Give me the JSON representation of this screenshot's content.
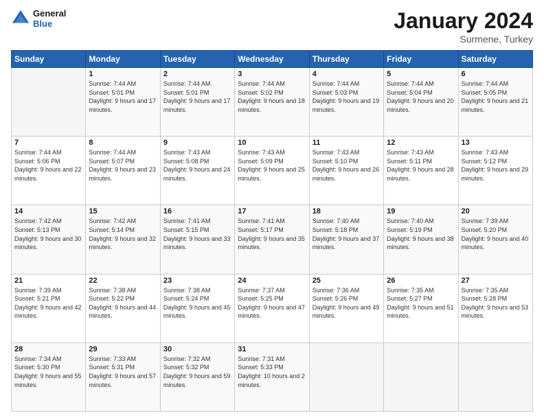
{
  "logo": {
    "line1": "General",
    "line2": "Blue"
  },
  "title": "January 2024",
  "subtitle": "Surmene, Turkey",
  "header": {
    "days": [
      "Sunday",
      "Monday",
      "Tuesday",
      "Wednesday",
      "Thursday",
      "Friday",
      "Saturday"
    ]
  },
  "weeks": [
    [
      {
        "day": "",
        "sunrise": "",
        "sunset": "",
        "daylight": ""
      },
      {
        "day": "1",
        "sunrise": "Sunrise: 7:44 AM",
        "sunset": "Sunset: 5:01 PM",
        "daylight": "Daylight: 9 hours and 17 minutes."
      },
      {
        "day": "2",
        "sunrise": "Sunrise: 7:44 AM",
        "sunset": "Sunset: 5:01 PM",
        "daylight": "Daylight: 9 hours and 17 minutes."
      },
      {
        "day": "3",
        "sunrise": "Sunrise: 7:44 AM",
        "sunset": "Sunset: 5:02 PM",
        "daylight": "Daylight: 9 hours and 18 minutes."
      },
      {
        "day": "4",
        "sunrise": "Sunrise: 7:44 AM",
        "sunset": "Sunset: 5:03 PM",
        "daylight": "Daylight: 9 hours and 19 minutes."
      },
      {
        "day": "5",
        "sunrise": "Sunrise: 7:44 AM",
        "sunset": "Sunset: 5:04 PM",
        "daylight": "Daylight: 9 hours and 20 minutes."
      },
      {
        "day": "6",
        "sunrise": "Sunrise: 7:44 AM",
        "sunset": "Sunset: 5:05 PM",
        "daylight": "Daylight: 9 hours and 21 minutes."
      }
    ],
    [
      {
        "day": "7",
        "sunrise": "Sunrise: 7:44 AM",
        "sunset": "Sunset: 5:06 PM",
        "daylight": "Daylight: 9 hours and 22 minutes."
      },
      {
        "day": "8",
        "sunrise": "Sunrise: 7:44 AM",
        "sunset": "Sunset: 5:07 PM",
        "daylight": "Daylight: 9 hours and 23 minutes."
      },
      {
        "day": "9",
        "sunrise": "Sunrise: 7:43 AM",
        "sunset": "Sunset: 5:08 PM",
        "daylight": "Daylight: 9 hours and 24 minutes."
      },
      {
        "day": "10",
        "sunrise": "Sunrise: 7:43 AM",
        "sunset": "Sunset: 5:09 PM",
        "daylight": "Daylight: 9 hours and 25 minutes."
      },
      {
        "day": "11",
        "sunrise": "Sunrise: 7:43 AM",
        "sunset": "Sunset: 5:10 PM",
        "daylight": "Daylight: 9 hours and 26 minutes."
      },
      {
        "day": "12",
        "sunrise": "Sunrise: 7:43 AM",
        "sunset": "Sunset: 5:11 PM",
        "daylight": "Daylight: 9 hours and 28 minutes."
      },
      {
        "day": "13",
        "sunrise": "Sunrise: 7:43 AM",
        "sunset": "Sunset: 5:12 PM",
        "daylight": "Daylight: 9 hours and 29 minutes."
      }
    ],
    [
      {
        "day": "14",
        "sunrise": "Sunrise: 7:42 AM",
        "sunset": "Sunset: 5:13 PM",
        "daylight": "Daylight: 9 hours and 30 minutes."
      },
      {
        "day": "15",
        "sunrise": "Sunrise: 7:42 AM",
        "sunset": "Sunset: 5:14 PM",
        "daylight": "Daylight: 9 hours and 32 minutes."
      },
      {
        "day": "16",
        "sunrise": "Sunrise: 7:41 AM",
        "sunset": "Sunset: 5:15 PM",
        "daylight": "Daylight: 9 hours and 33 minutes."
      },
      {
        "day": "17",
        "sunrise": "Sunrise: 7:41 AM",
        "sunset": "Sunset: 5:17 PM",
        "daylight": "Daylight: 9 hours and 35 minutes."
      },
      {
        "day": "18",
        "sunrise": "Sunrise: 7:40 AM",
        "sunset": "Sunset: 5:18 PM",
        "daylight": "Daylight: 9 hours and 37 minutes."
      },
      {
        "day": "19",
        "sunrise": "Sunrise: 7:40 AM",
        "sunset": "Sunset: 5:19 PM",
        "daylight": "Daylight: 9 hours and 38 minutes."
      },
      {
        "day": "20",
        "sunrise": "Sunrise: 7:39 AM",
        "sunset": "Sunset: 5:20 PM",
        "daylight": "Daylight: 9 hours and 40 minutes."
      }
    ],
    [
      {
        "day": "21",
        "sunrise": "Sunrise: 7:39 AM",
        "sunset": "Sunset: 5:21 PM",
        "daylight": "Daylight: 9 hours and 42 minutes."
      },
      {
        "day": "22",
        "sunrise": "Sunrise: 7:38 AM",
        "sunset": "Sunset: 5:22 PM",
        "daylight": "Daylight: 9 hours and 44 minutes."
      },
      {
        "day": "23",
        "sunrise": "Sunrise: 7:38 AM",
        "sunset": "Sunset: 5:24 PM",
        "daylight": "Daylight: 9 hours and 45 minutes."
      },
      {
        "day": "24",
        "sunrise": "Sunrise: 7:37 AM",
        "sunset": "Sunset: 5:25 PM",
        "daylight": "Daylight: 9 hours and 47 minutes."
      },
      {
        "day": "25",
        "sunrise": "Sunrise: 7:36 AM",
        "sunset": "Sunset: 5:26 PM",
        "daylight": "Daylight: 9 hours and 49 minutes."
      },
      {
        "day": "26",
        "sunrise": "Sunrise: 7:35 AM",
        "sunset": "Sunset: 5:27 PM",
        "daylight": "Daylight: 9 hours and 51 minutes."
      },
      {
        "day": "27",
        "sunrise": "Sunrise: 7:35 AM",
        "sunset": "Sunset: 5:28 PM",
        "daylight": "Daylight: 9 hours and 53 minutes."
      }
    ],
    [
      {
        "day": "28",
        "sunrise": "Sunrise: 7:34 AM",
        "sunset": "Sunset: 5:30 PM",
        "daylight": "Daylight: 9 hours and 55 minutes."
      },
      {
        "day": "29",
        "sunrise": "Sunrise: 7:33 AM",
        "sunset": "Sunset: 5:31 PM",
        "daylight": "Daylight: 9 hours and 57 minutes."
      },
      {
        "day": "30",
        "sunrise": "Sunrise: 7:32 AM",
        "sunset": "Sunset: 5:32 PM",
        "daylight": "Daylight: 9 hours and 59 minutes."
      },
      {
        "day": "31",
        "sunrise": "Sunrise: 7:31 AM",
        "sunset": "Sunset: 5:33 PM",
        "daylight": "Daylight: 10 hours and 2 minutes."
      },
      {
        "day": "",
        "sunrise": "",
        "sunset": "",
        "daylight": ""
      },
      {
        "day": "",
        "sunrise": "",
        "sunset": "",
        "daylight": ""
      },
      {
        "day": "",
        "sunrise": "",
        "sunset": "",
        "daylight": ""
      }
    ]
  ]
}
